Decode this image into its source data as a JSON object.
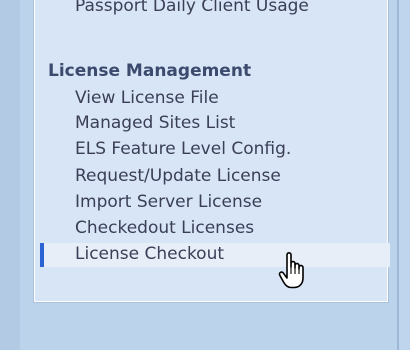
{
  "nav": {
    "top_item": "Passport Daily Client Usage",
    "section_title": "License Management",
    "items": [
      "View License File",
      "Managed Sites List",
      "ELS Feature Level Config.",
      "Request/Update License",
      "Import Server License",
      "Checkedout Licenses"
    ],
    "selected_item": "License Checkout"
  },
  "icons": {
    "cursor": "hand-pointer-icon"
  },
  "colors": {
    "selection_marker": "#2c63d2",
    "panel_bg": "#d7e5f6",
    "page_bg": "#bcd3ec"
  }
}
